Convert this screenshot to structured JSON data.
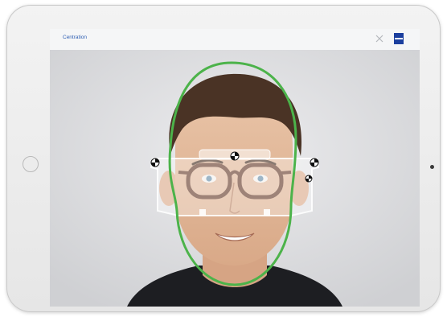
{
  "app": {
    "title": "Centration"
  },
  "icons": {
    "close": "close-icon",
    "logo": "zeiss-logo",
    "home": "home-button"
  },
  "colors": {
    "accent": "#2f5fb3",
    "brand_blue": "#1b3f9e",
    "face_outline": "#4cb34a",
    "background": "#dcdddf"
  }
}
